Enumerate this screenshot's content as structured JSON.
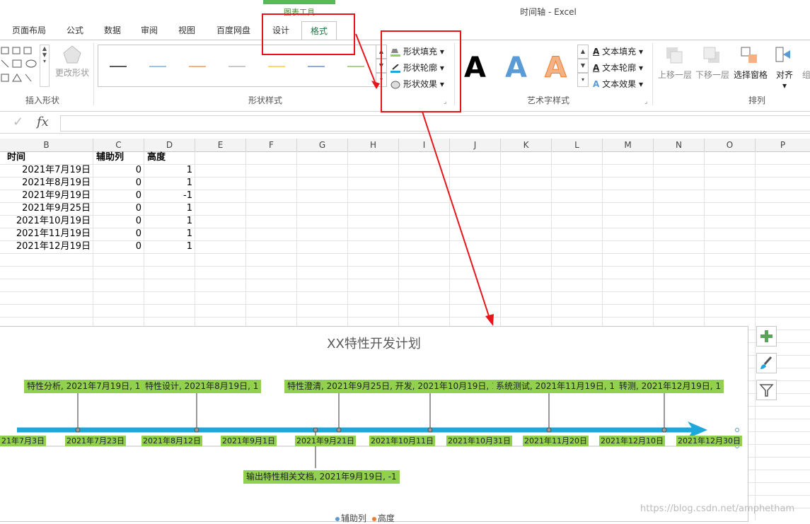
{
  "titlebar": {
    "chart_tools": "图表工具",
    "window_title": "时间轴 - Excel"
  },
  "tabs": [
    "页面布局",
    "公式",
    "数据",
    "审阅",
    "视图",
    "百度网盘",
    "设计",
    "格式"
  ],
  "ribbon": {
    "insert_shape": {
      "change_shape": "更改形状",
      "group": "插入形状"
    },
    "shape_styles": {
      "group": "形状样式",
      "fill": "形状填充",
      "outline": "形状轮廓",
      "effects": "形状效果",
      "line_colors": [
        "#595959",
        "#9dc3e6",
        "#f4b183",
        "#c9c9c9",
        "#ffd966",
        "#8faadc",
        "#a9d18e"
      ]
    },
    "wordart_styles": {
      "group": "艺术字样式",
      "glyph": "A",
      "text_fill": "文本填充",
      "text_outline": "文本轮廓",
      "text_effects": "文本效果"
    },
    "arrange": {
      "group": "排列",
      "bring_forward": "上移一层",
      "send_backward": "下移一层",
      "selection_pane": "选择窗格",
      "align": "对齐",
      "group_btn": "组"
    }
  },
  "formula_bar": {
    "fx": "fx",
    "check": "✓",
    "value": ""
  },
  "columns": [
    "B",
    "C",
    "D",
    "E",
    "F",
    "G",
    "H",
    "I",
    "J",
    "K",
    "L",
    "M",
    "N",
    "O",
    "P"
  ],
  "table": {
    "headers": [
      "时间",
      "辅助列",
      "高度"
    ],
    "rows": [
      [
        "2021年7月19日",
        "0",
        "1"
      ],
      [
        "2021年8月19日",
        "0",
        "1"
      ],
      [
        "2021年9月19日",
        "0",
        "-1"
      ],
      [
        "2021年9月25日",
        "0",
        "1"
      ],
      [
        "2021年10月19日",
        "0",
        "1"
      ],
      [
        "2021年11月19日",
        "0",
        "1"
      ],
      [
        "2021年12月19日",
        "0",
        "1"
      ]
    ]
  },
  "chart": {
    "title": "XX特性开发计划",
    "data_labels_above": [
      "特性分析, 2021年7月19日, 1",
      "特性设计, 2021年8月19日, 1",
      "特性澄清, 2021年9月25日, 开发, 2021年10月19日, 1",
      "系统测试, 2021年11月19日, 1",
      "转测, 2021年12月19日, 1"
    ],
    "data_label_below": "输出特性相关文档, 2021年9月19日, -1",
    "axis_ticks": [
      "21年7月3日",
      "2021年7月23日",
      "2021年8月12日",
      "2021年9月1日",
      "2021年9月21日",
      "2021年10月11日",
      "2021年10月31日",
      "2021年11月20日",
      "2021年12月10日",
      "2021年12月30日"
    ],
    "legend": [
      "辅助列",
      "高度"
    ],
    "colors": {
      "arrow": "#1ea7db",
      "label_bg": "#92d050",
      "legend_1": "#5b9bd5",
      "legend_2": "#ed7d31"
    }
  },
  "chart_side_buttons": [
    "plus-icon",
    "brush-icon",
    "filter-icon"
  ],
  "watermark": "https://blog.csdn.net/amphetham"
}
